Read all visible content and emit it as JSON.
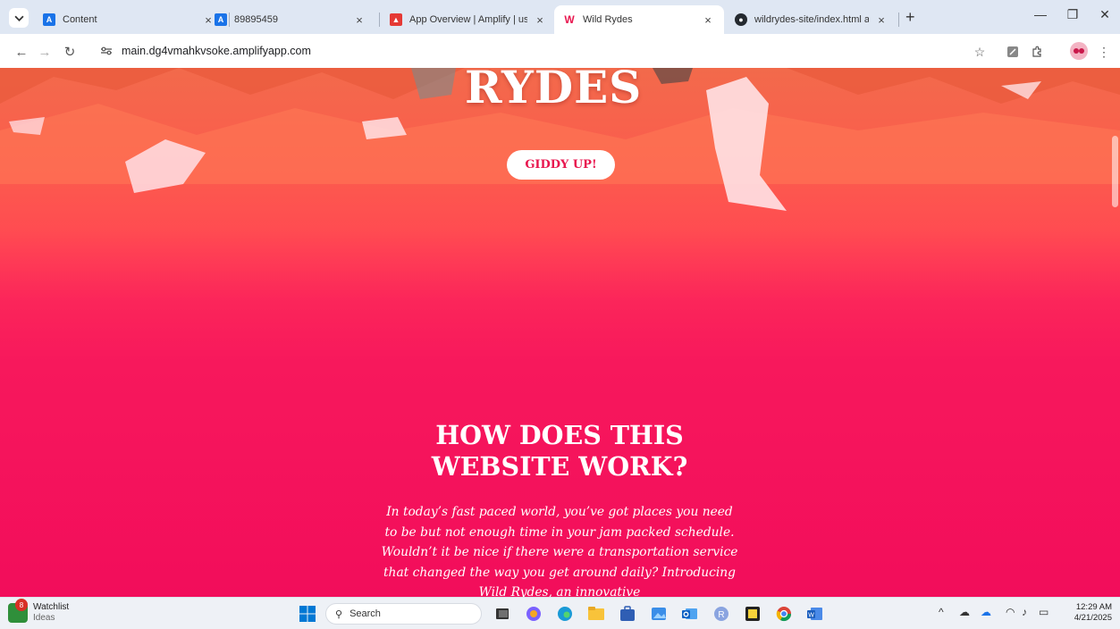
{
  "browser": {
    "tabs": [
      {
        "label": "Content",
        "favicon": "amplify-icon",
        "color": "#1a73e8"
      },
      {
        "label": "89895459",
        "favicon": "amplify-icon",
        "color": "#1a73e8"
      },
      {
        "label": "App Overview | Amplify | us-ea",
        "favicon": "aws-amplify-icon",
        "color": "#e53935"
      },
      {
        "label": "Wild Rydes",
        "favicon": "wild-rydes-icon",
        "color": "#e8174f",
        "active": true
      },
      {
        "label": "wildrydes-site/index.html at ma",
        "favicon": "github-icon",
        "color": "#24292f"
      }
    ],
    "new_tab_label": "+",
    "url": "main.dg4vmahkvsoke.amplifyapp.com"
  },
  "page": {
    "hero_word": "RYDES",
    "cta_label": "GIDDY UP!",
    "section_heading": "HOW DOES THIS WEBSITE WORK?",
    "section_body": "In today’s fast paced world, you’ve got places you need to be but not enough time in your jam packed schedule. Wouldn’t it be nice if there were a transportation service that changed the way you get around daily? Introducing Wild Rydes, an innovative",
    "colors": {
      "accent": "#e8174f",
      "background": "#f20d5b"
    }
  },
  "taskbar": {
    "widget_title": "Watchlist",
    "widget_subtitle": "Ideas",
    "widget_badge": "8",
    "search_label": "Search",
    "time": "12:29 AM",
    "date": "4/21/2025"
  }
}
